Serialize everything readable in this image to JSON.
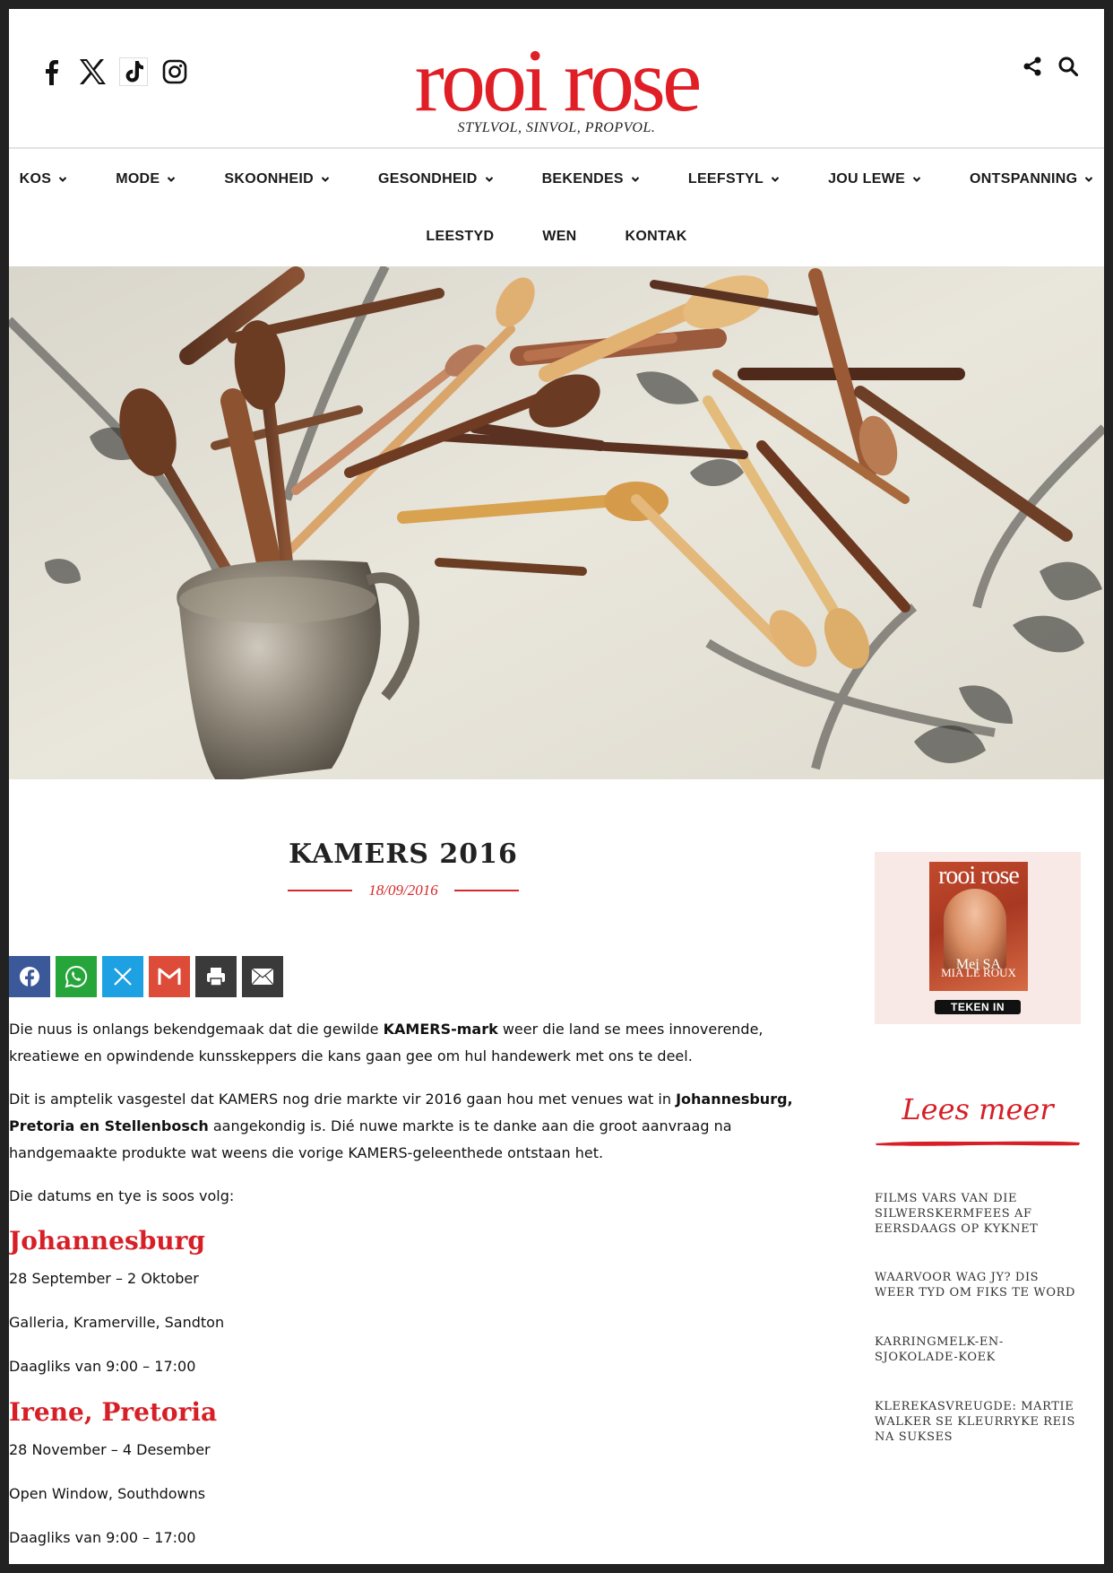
{
  "header": {
    "logo": "rooi rose",
    "tagline": "STYLVOL, SINVOL, PROPVOL.",
    "social_icons": [
      "facebook-icon",
      "x-icon",
      "tiktok-icon",
      "instagram-icon"
    ],
    "tool_icons": [
      "share-icon",
      "search-icon"
    ]
  },
  "nav": {
    "row1": [
      {
        "label": "KOS",
        "has_dropdown": true
      },
      {
        "label": "MODE",
        "has_dropdown": true
      },
      {
        "label": "SKOONHEID",
        "has_dropdown": true
      },
      {
        "label": "GESONDHEID",
        "has_dropdown": true
      },
      {
        "label": "BEKENDES",
        "has_dropdown": true
      },
      {
        "label": "LEEFSTYL",
        "has_dropdown": true
      },
      {
        "label": "JOU LEWE",
        "has_dropdown": true
      },
      {
        "label": "ONTSPANNING",
        "has_dropdown": true
      }
    ],
    "row2": [
      {
        "label": "LEESTYD",
        "has_dropdown": false
      },
      {
        "label": "WEN",
        "has_dropdown": false
      },
      {
        "label": "KONTAK",
        "has_dropdown": false
      }
    ]
  },
  "article": {
    "title": "KAMERS 2016",
    "date": "18/09/2016",
    "share_buttons": [
      "facebook-icon",
      "whatsapp-icon",
      "x-icon",
      "gmail-icon",
      "print-icon",
      "email-icon"
    ],
    "p1_a": "Die nuus is onlangs bekendgemaak dat die gewilde ",
    "p1_b": "KAMERS-mark",
    "p1_c": " weer die land se mees innoverende, kreatiewe en opwindende kunsskeppers die kans gaan gee om hul handewerk met ons te deel.",
    "p2_a": "Dit is amptelik vasgestel dat KAMERS nog drie markte vir 2016 gaan hou met venues wat in ",
    "p2_b": "Johannesburg, Pretoria en Stellenbosch",
    "p2_c": " aangekondig is. Dié nuwe markte is te danke aan die groot aanvraag na handgemaakte produkte wat weens die vorige KAMERS-geleenthede ontstaan het.",
    "p3": "Die datums en tye is soos volg:",
    "events": [
      {
        "city": "Johannesburg",
        "dates": "28 September – 2 Oktober",
        "venue": "Galleria, Kramerville, Sandton",
        "hours": "Daagliks van 9:00 – 17:00"
      },
      {
        "city": "Irene, Pretoria",
        "dates": "28 November – 4 Desember",
        "venue": "Open Window, Southdowns",
        "hours": "Daagliks van 9:00 – 17:00"
      }
    ]
  },
  "sidebar": {
    "magazine": {
      "cover_logo": "rooi rose",
      "cover_headline": "Mej SA",
      "cover_name": "MIA LE ROUX",
      "cta": "TEKEN IN"
    },
    "lees_meer": "Lees meer",
    "related": [
      "FILMS VARS VAN DIE SILWERSKERMFEES AF EERSDAAGS OP KYKNET",
      "WAARVOOR WAG JY? DIS WEER TYD OM FIKS TE WORD",
      "KARRINGMELK-EN-SJOKOLADE-KOEK",
      "KLEREKASVREUGDE: MARTIE WALKER SE KLEURRYKE REIS NA SUKSES"
    ]
  },
  "colors": {
    "brand_red": "#e01e26",
    "accent_red": "#d61f26",
    "frame": "#222222",
    "facebook": "#3b5998",
    "whatsapp": "#25a53a",
    "x_share": "#1da1e2",
    "gmail": "#dd4b39",
    "dark_share": "#3a3a3a"
  }
}
